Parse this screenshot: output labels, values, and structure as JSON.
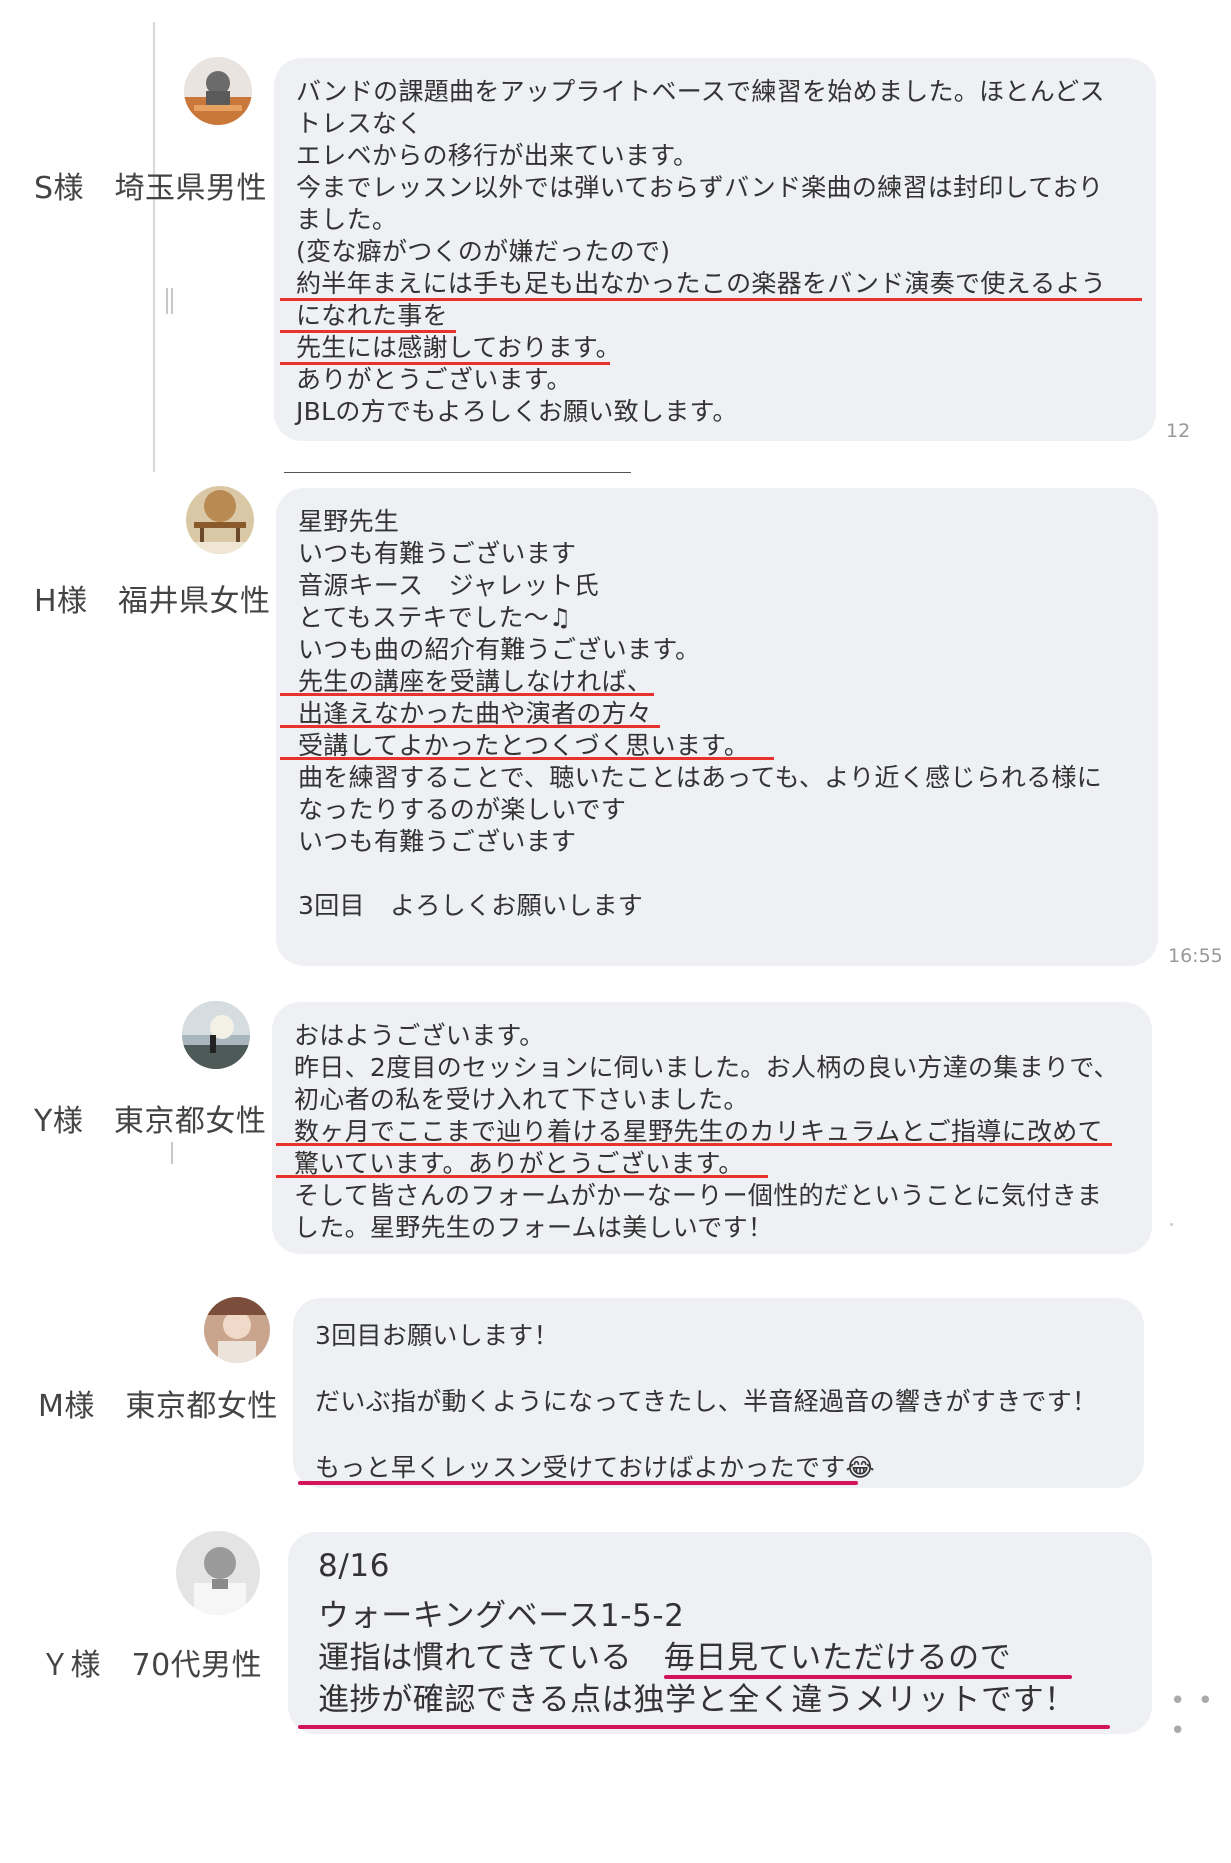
{
  "testimonials": [
    {
      "name": "S様　埼玉県男性",
      "lines": [
        "バンドの課題曲をアップライトベースで練習を始めました。ほとんどス",
        "トレスなく",
        "エレベからの移行が出来ています。",
        "今までレッスン以外では弾いておらずバンド楽曲の練習は封印しており",
        "ました。",
        "(変な癖がつくのが嫌だったので)",
        "約半年まえには手も足も出なかったこの楽器をバンド演奏で使えるよう",
        "になれた事を",
        "先生には感謝しております。",
        "ありがとうございます。",
        "JBLの方でもよろしくお願い致します。"
      ],
      "time": "12"
    },
    {
      "name": "H様　福井県女性",
      "lines": [
        "星野先生",
        "いつも有難うございます",
        "音源キース　ジャレット氏",
        "とてもステキでした〜♫",
        "いつも曲の紹介有難うございます。",
        "先生の講座を受講しなければ、",
        "出逢えなかった曲や演者の方々",
        "受講してよかったとつくづく思います。",
        "曲を練習することで、聴いたことはあっても、より近く感じられる様に",
        "なったりするのが楽しいです",
        "いつも有難うございます",
        "",
        "3回目　よろしくお願いします"
      ],
      "time": "16:55"
    },
    {
      "name": "Y様　東京都女性",
      "lines": [
        "おはようございます。",
        "昨日、2度目のセッションに伺いました。お人柄の良い方達の集まりで、",
        "初心者の私を受け入れて下さいました。",
        "数ヶ月でここまで辿り着ける星野先生のカリキュラムとご指導に改めて",
        "驚いています。ありがとうございます。",
        "そして皆さんのフォームがかーなーりー個性的だということに気付きま",
        "した。星野先生のフォームは美しいです！"
      ]
    },
    {
      "name": "M様　東京都女性",
      "lines": [
        "3回目お願いします！",
        "",
        "だいぶ指が動くようになってきたし、半音経過音の響きがすきです！",
        "",
        "もっと早くレッスン受けておけばよかったです😂"
      ]
    },
    {
      "name": "Ｙ様　70代男性",
      "lines": [
        "8/16",
        "ウォーキングベース1-5-2",
        "運指は慣れてきている　毎日見ていただけるので",
        "進捗が確認できる点は独学と全く違うメリットです！"
      ],
      "more": "• • •"
    }
  ],
  "colors": {
    "bubble": "#eef0f3",
    "underline_red": "#e8322b",
    "underline_pink": "#d4145a"
  }
}
